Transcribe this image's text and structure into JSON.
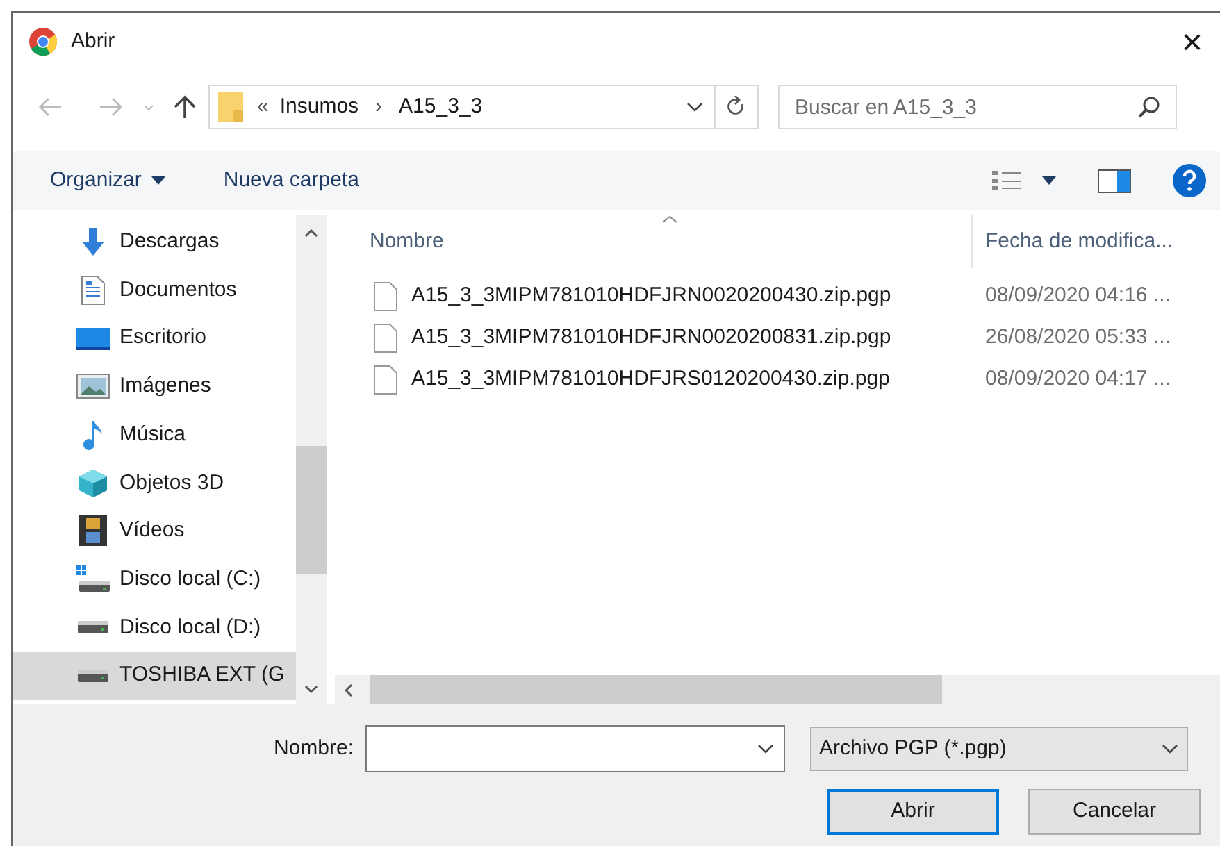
{
  "window": {
    "title": "Abrir",
    "close": "×"
  },
  "address_bar": {
    "overflow": "«",
    "path": [
      "Insumos",
      "A15_3_3"
    ],
    "separator": "›"
  },
  "search": {
    "placeholder": "Buscar en A15_3_3"
  },
  "toolbar": {
    "organize": "Organizar",
    "new_folder": "Nueva carpeta"
  },
  "sidebar": {
    "items": [
      {
        "label": "Descargas",
        "kind": "downloads",
        "selected": false
      },
      {
        "label": "Documentos",
        "kind": "documents",
        "selected": false
      },
      {
        "label": "Escritorio",
        "kind": "desktop",
        "selected": false
      },
      {
        "label": "Imágenes",
        "kind": "pictures",
        "selected": false
      },
      {
        "label": "Música",
        "kind": "music",
        "selected": false
      },
      {
        "label": "Objetos 3D",
        "kind": "objects",
        "selected": false
      },
      {
        "label": "Vídeos",
        "kind": "videos",
        "selected": false
      },
      {
        "label": "Disco local (C:)",
        "kind": "system-drive",
        "selected": false
      },
      {
        "label": "Disco local (D:)",
        "kind": "drive",
        "selected": false
      },
      {
        "label": "TOSHIBA EXT (G",
        "kind": "drive",
        "selected": true
      }
    ]
  },
  "file_list": {
    "columns": [
      "Nombre",
      "Fecha de modifica..."
    ],
    "rows": [
      {
        "name": "A15_3_3MIPM781010HDFJRN0020200430.zip.pgp",
        "date": "08/09/2020 04:16 ..."
      },
      {
        "name": "A15_3_3MIPM781010HDFJRN0020200831.zip.pgp",
        "date": "26/08/2020 05:33 ..."
      },
      {
        "name": "A15_3_3MIPM781010HDFJRS0120200430.zip.pgp",
        "date": "08/09/2020 04:17 ..."
      }
    ]
  },
  "footer": {
    "name_label": "Nombre:",
    "file_type": "Archivo PGP (*.pgp)",
    "buttons": [
      "Abrir",
      "Cancelar"
    ]
  }
}
